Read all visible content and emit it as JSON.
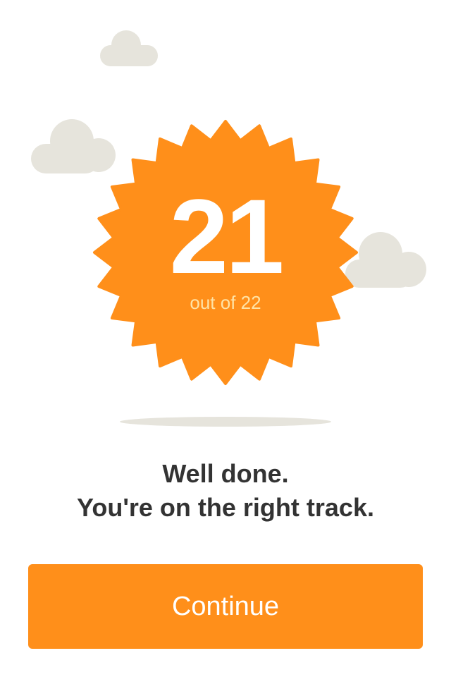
{
  "result": {
    "score": "21",
    "total_label": "out of 22"
  },
  "message": {
    "line1": "Well done.",
    "line2": "You're on the right track."
  },
  "actions": {
    "continue_label": "Continue"
  },
  "colors": {
    "accent": "#ff8f1a",
    "cloud": "#e6e4dc",
    "text": "#333333",
    "background": "#ffffff"
  },
  "icons": {
    "badge": "starburst-badge-icon",
    "clouds": [
      "cloud-icon",
      "cloud-icon",
      "cloud-icon"
    ]
  }
}
